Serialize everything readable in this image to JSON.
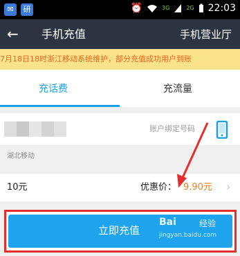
{
  "status_bar": {
    "time": "22:03",
    "network_top": "3G",
    "network_bottom": "2G",
    "notifications": [
      "mail",
      "app"
    ]
  },
  "app_bar": {
    "title": "手机充值",
    "action": "手机营业厅"
  },
  "notice": {
    "text": "7月18日18时浙江移动系统维护，部分充值成功用户到账"
  },
  "tabs": [
    {
      "label": "充话费",
      "active": true
    },
    {
      "label": "充流量",
      "active": false
    }
  ],
  "phone": {
    "hint": "账户绑定号码"
  },
  "carrier": {
    "label": "湖北移动"
  },
  "amount": {
    "value": "10元",
    "discount_label": "优惠价：",
    "discount_price": "9.90元"
  },
  "recharge": {
    "label": "立即充值"
  },
  "watermark": {
    "logo": "Bai",
    "brand": "经验",
    "url": "jingyan.baidu.com"
  },
  "colors": {
    "accent": "#1a9fe8",
    "price": "#f07b1f",
    "annotation": "#e52d2d",
    "notice_bg": "#fbe38b",
    "app_bar": "#2c3441"
  },
  "icons": [
    "back-arrow-icon",
    "alarm-icon",
    "wifi-icon",
    "signal-icon",
    "battery-icon",
    "phone-contact-icon",
    "chevron-right-icon"
  ]
}
